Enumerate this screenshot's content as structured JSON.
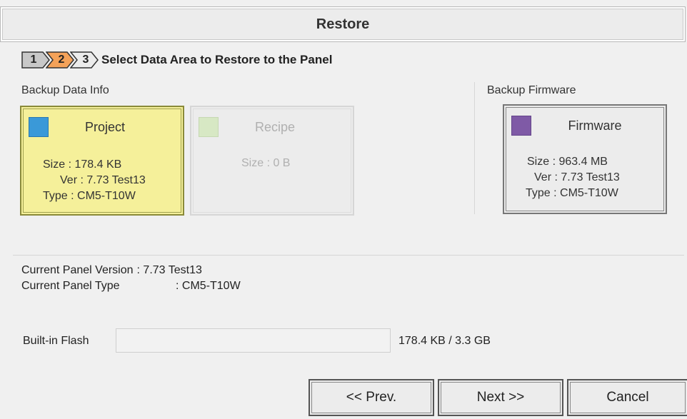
{
  "dialog": {
    "title": "Restore"
  },
  "wizard": {
    "steps": [
      {
        "num": "1",
        "state": "done",
        "color": "#c8c8c8"
      },
      {
        "num": "2",
        "state": "active",
        "color": "#f4a259"
      },
      {
        "num": "3",
        "state": "pending",
        "color": "#ececec"
      }
    ],
    "step_title": "Select Data Area to Restore to the Panel"
  },
  "backup_data": {
    "label": "Backup Data Info",
    "project": {
      "title": "Project",
      "swatch_color": "#3a99d8",
      "size": "Size : 178.4 KB",
      "ver": "Ver : 7.73 Test13",
      "type": "Type : CM5-T10W",
      "selected": true
    },
    "recipe": {
      "title": "Recipe",
      "swatch_color": "#d7e8c4",
      "size": "Size : 0 B",
      "enabled": false
    }
  },
  "backup_firmware": {
    "label": "Backup Firmware",
    "firmware": {
      "title": "Firmware",
      "swatch_color": "#7f5aa6",
      "size": "Size : 963.4 MB",
      "ver": "Ver : 7.73 Test13",
      "type": "Type : CM5-T10W"
    }
  },
  "panel": {
    "version_label": "Current Panel Version",
    "version_value": ": 7.73 Test13",
    "type_label": "Current Panel Type",
    "type_value": ": CM5-T10W"
  },
  "flash": {
    "label": "Built-in Flash",
    "usage_text": "178.4 KB / 3.3 GB",
    "used_fraction": 5e-05
  },
  "buttons": {
    "prev": "<< Prev.",
    "next": "Next >>",
    "cancel": "Cancel"
  },
  "colors": {
    "selected_card": "#f5f09a",
    "active_step": "#f4a259"
  }
}
